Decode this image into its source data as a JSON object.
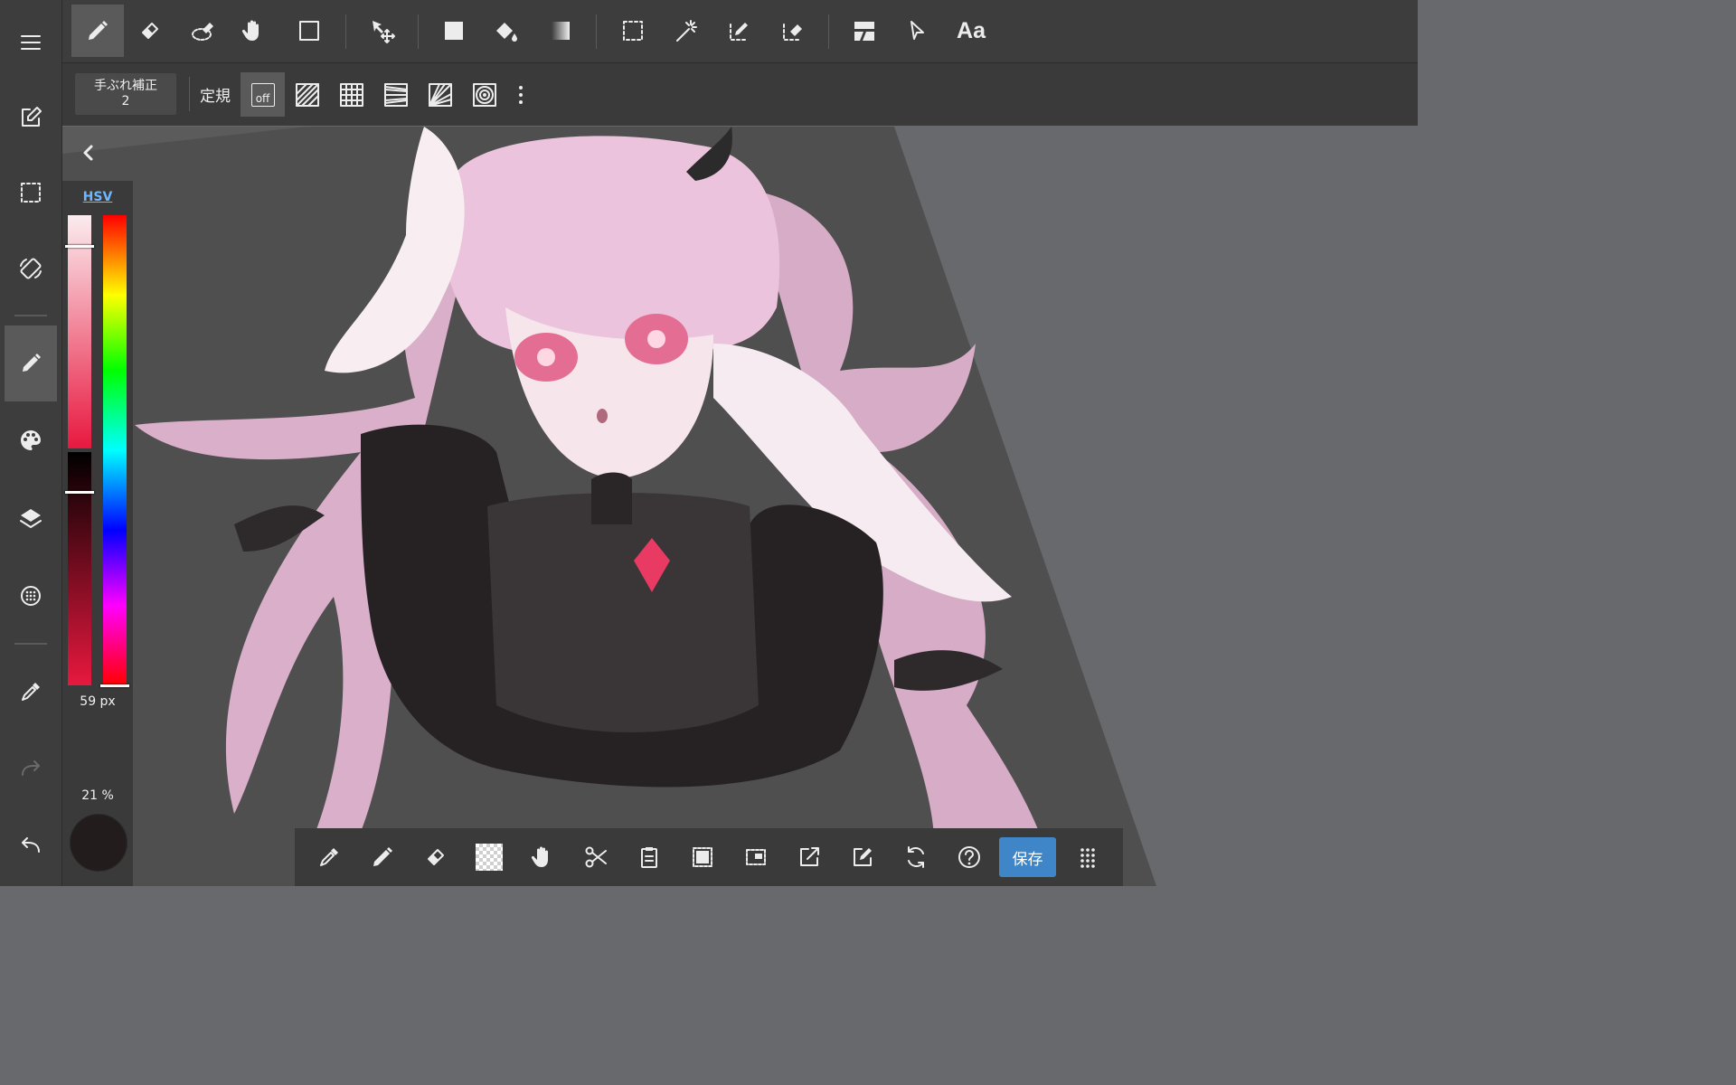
{
  "toolbar": {
    "tools": [
      {
        "icon": "pen-icon",
        "active": true
      },
      {
        "icon": "eraser-icon"
      },
      {
        "icon": "blur-eraser-icon"
      },
      {
        "icon": "hand-icon"
      },
      {
        "icon": "rectangle-shape-icon"
      },
      {
        "icon": "move-icon"
      },
      {
        "icon": "fill-rect-icon"
      },
      {
        "icon": "bucket-icon"
      },
      {
        "icon": "gradient-icon"
      },
      {
        "icon": "select-rect-icon"
      },
      {
        "icon": "magic-wand-icon"
      },
      {
        "icon": "select-pen-icon"
      },
      {
        "icon": "select-eraser-icon"
      },
      {
        "icon": "divide-tool-icon"
      },
      {
        "icon": "cursor-icon"
      },
      {
        "icon": "text-icon",
        "label": "Aa"
      }
    ]
  },
  "subbar": {
    "stabilizer_label": "手ぶれ補正",
    "stabilizer_value": "2",
    "ruler_label": "定規",
    "ruler_off_label": "off",
    "rulers": [
      "parallel-ruler-icon",
      "grid-ruler-icon",
      "perspective-ruler-icon",
      "radial-ruler-icon",
      "concentric-ruler-icon"
    ]
  },
  "color_panel": {
    "mode_label": "HSV",
    "brush_size": "59 px",
    "opacity": "21 %",
    "current_color": "#221c1d",
    "saturation_level": 0.13,
    "value_level": 0.17,
    "hue_level": 0.0
  },
  "sidebar": {
    "items": [
      "menu-icon",
      "edit-icon",
      "selection-icon",
      "rotate-icon",
      "brush-icon",
      "palette-icon",
      "layers-icon",
      "material-icon",
      "eyedropper-icon",
      "redo-icon",
      "undo-icon"
    ]
  },
  "bottombar": {
    "items": [
      "eyedropper-icon",
      "pen-icon",
      "eraser-icon",
      "transparent-icon",
      "hand-icon",
      "cut-icon",
      "paste-icon",
      "select-all-icon",
      "deselect-icon",
      "export-icon",
      "import-icon",
      "transform-icon",
      "help-icon"
    ],
    "save_label": "保存"
  },
  "colors": {
    "accent": "#3f86c9",
    "toolbar_bg": "#3d3d3d",
    "canvas_bg": "#68696d"
  }
}
